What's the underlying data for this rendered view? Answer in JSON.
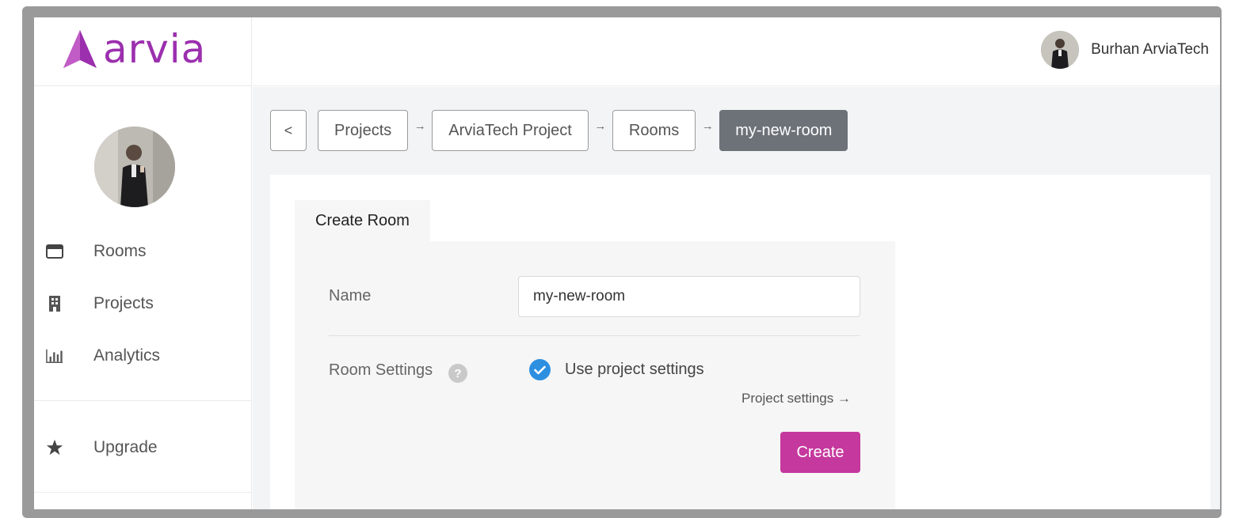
{
  "brand": {
    "name": "arvia",
    "color": "#9b2fae"
  },
  "header": {
    "user_name": "Burhan ArviaTech"
  },
  "sidebar": {
    "items": [
      {
        "label": "Rooms",
        "icon": "window-icon"
      },
      {
        "label": "Projects",
        "icon": "building-icon"
      },
      {
        "label": "Analytics",
        "icon": "bar-chart-icon"
      },
      {
        "label": "Upgrade",
        "icon": "star-icon"
      }
    ]
  },
  "breadcrumb": {
    "back_label": "<",
    "separator": "→",
    "items": [
      "Projects",
      "ArviaTech Project",
      "Rooms",
      "my-new-room"
    ]
  },
  "form": {
    "tab_label": "Create Room",
    "name_label": "Name",
    "name_value": "my-new-room",
    "settings_label": "Room Settings",
    "help_glyph": "?",
    "use_project_settings_label": "Use project settings",
    "use_project_settings_checked": true,
    "project_settings_link": "Project settings →",
    "create_button": "Create"
  },
  "colors": {
    "accent": "#c5389d",
    "check": "#2d8fe0",
    "active_crumb": "#6d7279"
  }
}
